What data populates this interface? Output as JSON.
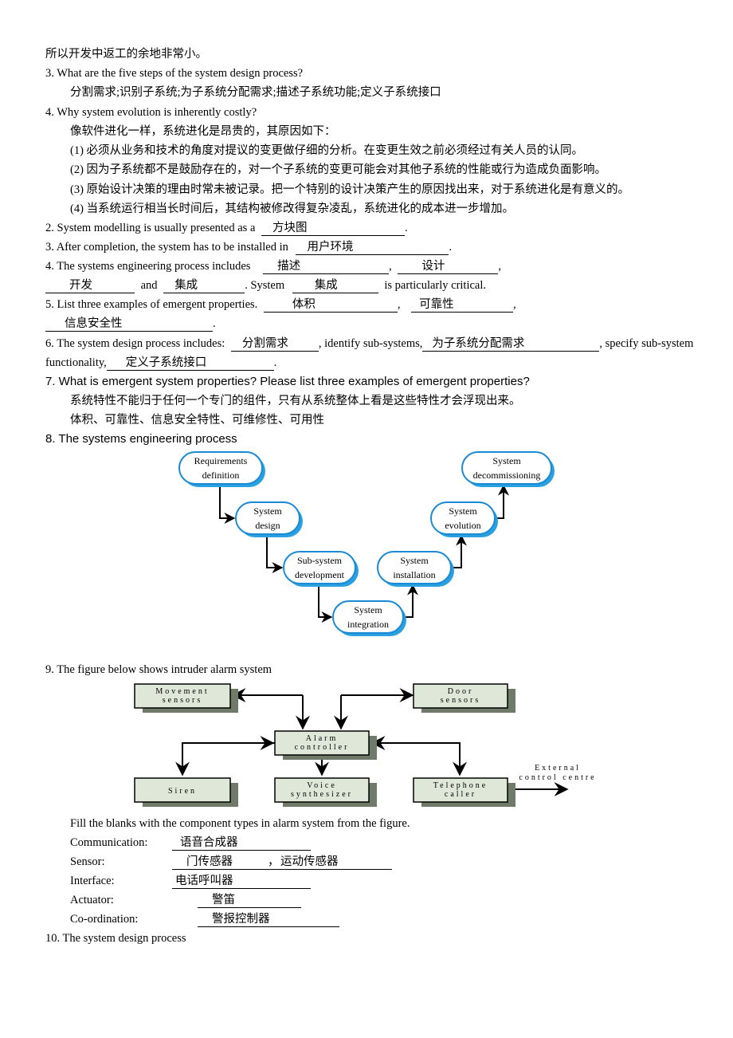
{
  "intro_tail": "所以开发中返工的余地非常小。",
  "q3": {
    "question": "3. What are the five steps of the system design process?",
    "answer": "分割需求;识别子系统;为子系统分配需求;描述子系统功能;定义子系统接口"
  },
  "q4": {
    "question": "4. Why system evolution is inherently costly?",
    "intro": "像软件进化一样，系统进化是昂贵的，其原因如下：",
    "reasons": [
      "(1)  必须从业务和技术的角度对提议的变更做仔细的分析。在变更生效之前必须经过有关人员的认同。",
      "(2)  因为子系统都不是鼓励存在的，对一个子系统的变更可能会对其他子系统的性能或行为造成负面影响。",
      "(3)  原始设计决策的理由时常未被记录。把一个特别的设计决策产生的原因找出来，对于系统进化是有意义的。",
      "(4)  当系统运行相当长时间后，其结构被修改得复杂凌乱，系统进化的成本进一步增加。"
    ]
  },
  "fill": {
    "f2": {
      "text": "2. System modelling is usually presented as a",
      "answer": "方块图",
      "end": "."
    },
    "f3": {
      "text": "3. After completion, the system has to be installed in",
      "answer": "用户环境",
      "end": "."
    },
    "f4": {
      "text": "4. The systems engineering process includes",
      "a1": "描述",
      "a2": "设计",
      "a3": "开发",
      "and": "and",
      "a4": "集成",
      "mid": ". System",
      "a5": "集成",
      "end": "is particularly critical."
    },
    "f5": {
      "text": "5. List three examples of emergent properties.",
      "a1": "体积",
      "a2": "可靠性",
      "a3": "信息安全性"
    },
    "f6": {
      "text": "6. The system design process includes:",
      "a1": "分割需求",
      "mid1": ", identify sub-systems,",
      "a2": "为子系统分配需求",
      "mid2": ", specify sub-system",
      "cont": "functionality,",
      "a3": "定义子系统接口"
    }
  },
  "q7": {
    "question": "7. What is emergent system properties? Please list three examples of emergent properties?",
    "answer1": "系统特性不能归于任何一个专门的组件，只有从系统整体上看是这些特性才会浮现出来。",
    "answer2": "体积、可靠性、信息安全特性、可维修性、可用性"
  },
  "q8": {
    "title": "8. The systems engineering process",
    "stages": [
      [
        "Requirements",
        "definition"
      ],
      [
        "System",
        "design"
      ],
      [
        "Sub-system",
        "development"
      ],
      [
        "System",
        "integration"
      ],
      [
        "System",
        "installation"
      ],
      [
        "System",
        "evolution"
      ],
      [
        "System",
        "decommissioning"
      ]
    ]
  },
  "q9": {
    "title": "9. The figure below shows intruder alarm system",
    "boxes": {
      "movement": [
        "Movement",
        "sensors"
      ],
      "door": [
        "Door",
        "sensors"
      ],
      "controller": [
        "Alarm",
        "controller"
      ],
      "siren": [
        "Siren"
      ],
      "voice": [
        "Voice",
        "synthesizer"
      ],
      "telephone": [
        "Telephone",
        "caller"
      ]
    },
    "external": [
      "External",
      "control centre"
    ],
    "instruction": "Fill the blanks with the component types in alarm system from the figure.",
    "rows": [
      {
        "label": "Communication:",
        "answer": "语音合成器"
      },
      {
        "label": "Sensor:",
        "answer": "门传感器",
        "sep": "，",
        "answer2": "运动传感器"
      },
      {
        "label": "Interface:",
        "answer": "电话呼叫器"
      },
      {
        "label": "Actuator:",
        "answer": "警笛"
      },
      {
        "label": "Co-ordination:",
        "answer": "警报控制器"
      }
    ]
  },
  "q10": {
    "title": "10. The system design process"
  },
  "colors": {
    "pill_stroke": "#1a8ad4",
    "pill_shadow": "#2aa0e0",
    "box_fill": "#dfe8d8",
    "box_shadow": "#6f7a68"
  }
}
